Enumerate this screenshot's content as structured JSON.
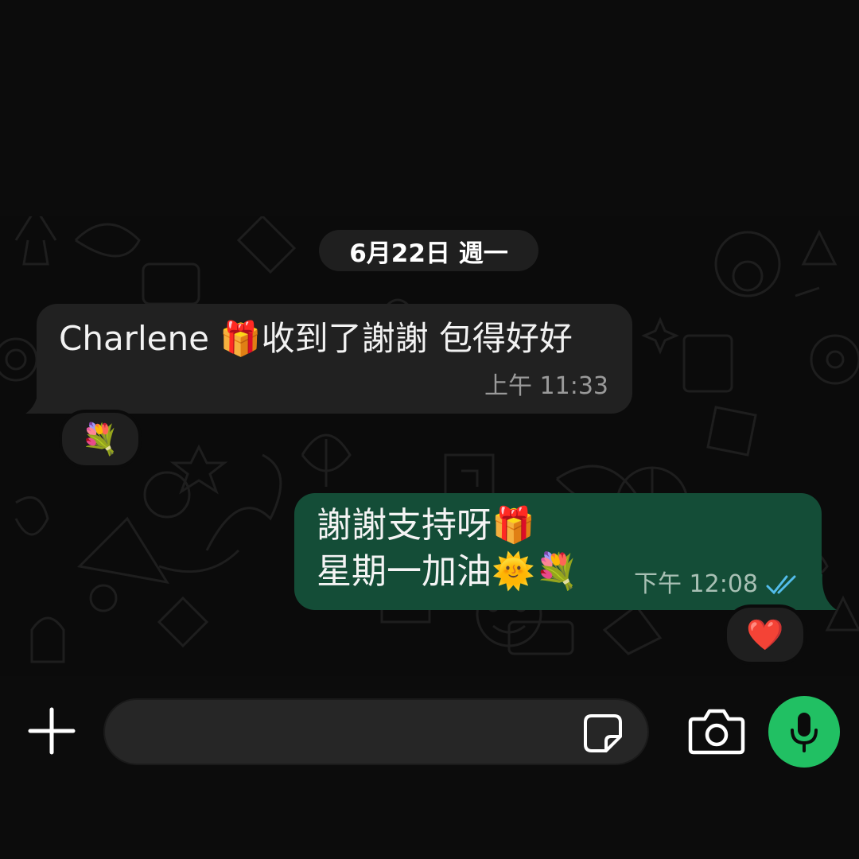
{
  "chat": {
    "date_label": "6月22日 週一",
    "incoming": {
      "text": "Charlene 🎁收到了謝謝 包得好好",
      "time": "上午 11:33",
      "reaction": "💐"
    },
    "outgoing": {
      "line1": "謝謝支持呀🎁",
      "line2": "星期一加油🌞💐",
      "time": "下午 12:08",
      "status_icon": "double-check-icon",
      "reaction": "❤️"
    }
  },
  "composer": {
    "input_value": "",
    "icons": [
      "plus-icon",
      "sticker-icon",
      "camera-icon",
      "microphone-icon"
    ]
  },
  "colors": {
    "incoming_bubble": "#212121",
    "outgoing_bubble": "#144d37",
    "mic_button": "#21c063",
    "read_ticks": "#53bdeb"
  }
}
